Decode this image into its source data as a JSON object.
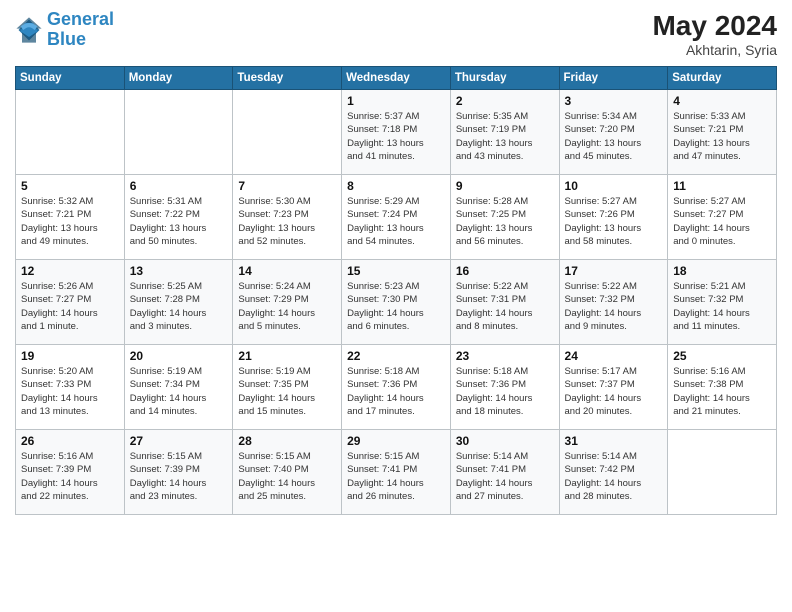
{
  "header": {
    "logo_line1": "General",
    "logo_line2": "Blue",
    "month_year": "May 2024",
    "location": "Akhtarin, Syria"
  },
  "weekdays": [
    "Sunday",
    "Monday",
    "Tuesday",
    "Wednesday",
    "Thursday",
    "Friday",
    "Saturday"
  ],
  "weeks": [
    [
      {
        "day": "",
        "info": ""
      },
      {
        "day": "",
        "info": ""
      },
      {
        "day": "",
        "info": ""
      },
      {
        "day": "1",
        "info": "Sunrise: 5:37 AM\nSunset: 7:18 PM\nDaylight: 13 hours\nand 41 minutes."
      },
      {
        "day": "2",
        "info": "Sunrise: 5:35 AM\nSunset: 7:19 PM\nDaylight: 13 hours\nand 43 minutes."
      },
      {
        "day": "3",
        "info": "Sunrise: 5:34 AM\nSunset: 7:20 PM\nDaylight: 13 hours\nand 45 minutes."
      },
      {
        "day": "4",
        "info": "Sunrise: 5:33 AM\nSunset: 7:21 PM\nDaylight: 13 hours\nand 47 minutes."
      }
    ],
    [
      {
        "day": "5",
        "info": "Sunrise: 5:32 AM\nSunset: 7:21 PM\nDaylight: 13 hours\nand 49 minutes."
      },
      {
        "day": "6",
        "info": "Sunrise: 5:31 AM\nSunset: 7:22 PM\nDaylight: 13 hours\nand 50 minutes."
      },
      {
        "day": "7",
        "info": "Sunrise: 5:30 AM\nSunset: 7:23 PM\nDaylight: 13 hours\nand 52 minutes."
      },
      {
        "day": "8",
        "info": "Sunrise: 5:29 AM\nSunset: 7:24 PM\nDaylight: 13 hours\nand 54 minutes."
      },
      {
        "day": "9",
        "info": "Sunrise: 5:28 AM\nSunset: 7:25 PM\nDaylight: 13 hours\nand 56 minutes."
      },
      {
        "day": "10",
        "info": "Sunrise: 5:27 AM\nSunset: 7:26 PM\nDaylight: 13 hours\nand 58 minutes."
      },
      {
        "day": "11",
        "info": "Sunrise: 5:27 AM\nSunset: 7:27 PM\nDaylight: 14 hours\nand 0 minutes."
      }
    ],
    [
      {
        "day": "12",
        "info": "Sunrise: 5:26 AM\nSunset: 7:27 PM\nDaylight: 14 hours\nand 1 minute."
      },
      {
        "day": "13",
        "info": "Sunrise: 5:25 AM\nSunset: 7:28 PM\nDaylight: 14 hours\nand 3 minutes."
      },
      {
        "day": "14",
        "info": "Sunrise: 5:24 AM\nSunset: 7:29 PM\nDaylight: 14 hours\nand 5 minutes."
      },
      {
        "day": "15",
        "info": "Sunrise: 5:23 AM\nSunset: 7:30 PM\nDaylight: 14 hours\nand 6 minutes."
      },
      {
        "day": "16",
        "info": "Sunrise: 5:22 AM\nSunset: 7:31 PM\nDaylight: 14 hours\nand 8 minutes."
      },
      {
        "day": "17",
        "info": "Sunrise: 5:22 AM\nSunset: 7:32 PM\nDaylight: 14 hours\nand 9 minutes."
      },
      {
        "day": "18",
        "info": "Sunrise: 5:21 AM\nSunset: 7:32 PM\nDaylight: 14 hours\nand 11 minutes."
      }
    ],
    [
      {
        "day": "19",
        "info": "Sunrise: 5:20 AM\nSunset: 7:33 PM\nDaylight: 14 hours\nand 13 minutes."
      },
      {
        "day": "20",
        "info": "Sunrise: 5:19 AM\nSunset: 7:34 PM\nDaylight: 14 hours\nand 14 minutes."
      },
      {
        "day": "21",
        "info": "Sunrise: 5:19 AM\nSunset: 7:35 PM\nDaylight: 14 hours\nand 15 minutes."
      },
      {
        "day": "22",
        "info": "Sunrise: 5:18 AM\nSunset: 7:36 PM\nDaylight: 14 hours\nand 17 minutes."
      },
      {
        "day": "23",
        "info": "Sunrise: 5:18 AM\nSunset: 7:36 PM\nDaylight: 14 hours\nand 18 minutes."
      },
      {
        "day": "24",
        "info": "Sunrise: 5:17 AM\nSunset: 7:37 PM\nDaylight: 14 hours\nand 20 minutes."
      },
      {
        "day": "25",
        "info": "Sunrise: 5:16 AM\nSunset: 7:38 PM\nDaylight: 14 hours\nand 21 minutes."
      }
    ],
    [
      {
        "day": "26",
        "info": "Sunrise: 5:16 AM\nSunset: 7:39 PM\nDaylight: 14 hours\nand 22 minutes."
      },
      {
        "day": "27",
        "info": "Sunrise: 5:15 AM\nSunset: 7:39 PM\nDaylight: 14 hours\nand 23 minutes."
      },
      {
        "day": "28",
        "info": "Sunrise: 5:15 AM\nSunset: 7:40 PM\nDaylight: 14 hours\nand 25 minutes."
      },
      {
        "day": "29",
        "info": "Sunrise: 5:15 AM\nSunset: 7:41 PM\nDaylight: 14 hours\nand 26 minutes."
      },
      {
        "day": "30",
        "info": "Sunrise: 5:14 AM\nSunset: 7:41 PM\nDaylight: 14 hours\nand 27 minutes."
      },
      {
        "day": "31",
        "info": "Sunrise: 5:14 AM\nSunset: 7:42 PM\nDaylight: 14 hours\nand 28 minutes."
      },
      {
        "day": "",
        "info": ""
      }
    ]
  ]
}
